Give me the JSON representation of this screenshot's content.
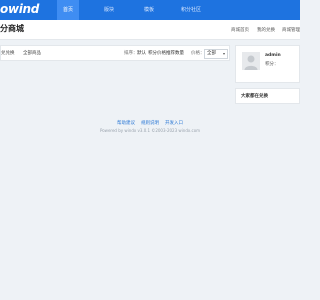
{
  "brand": {
    "logo_text": "owind"
  },
  "nav": {
    "items": [
      {
        "label": "首页",
        "active": true
      },
      {
        "label": "版块",
        "active": false
      },
      {
        "label": "模板",
        "active": false
      },
      {
        "label": "积分社区",
        "active": false
      }
    ]
  },
  "subheader": {
    "title": "分商城",
    "links": [
      "商城首页",
      "我的兑换",
      "商城管理"
    ]
  },
  "main": {
    "tabs": [
      "兑兑换",
      "全部商品"
    ],
    "sort_label": "排序：",
    "sort_options": [
      "默认",
      "积分价格",
      "推荐数量"
    ],
    "filter_label": "价格：",
    "filter_value": "全部",
    "chevron_icon": "chevron-down-icon"
  },
  "user": {
    "name": "admin",
    "points_label": "积分：",
    "avatar_icon": "user-avatar-icon"
  },
  "exchange": {
    "title": "大家都在兑换"
  },
  "footer": {
    "links": [
      "帮助建议",
      "规则说明",
      "开发入口"
    ],
    "powered": "Powered by windx v3.0.1 ©2003-2023 windx.com"
  },
  "colors": {
    "nav_bg": "#1e73e0",
    "nav_active": "#3f8df2",
    "page_bg": "#eef2f6",
    "link": "#2e7ad6"
  }
}
